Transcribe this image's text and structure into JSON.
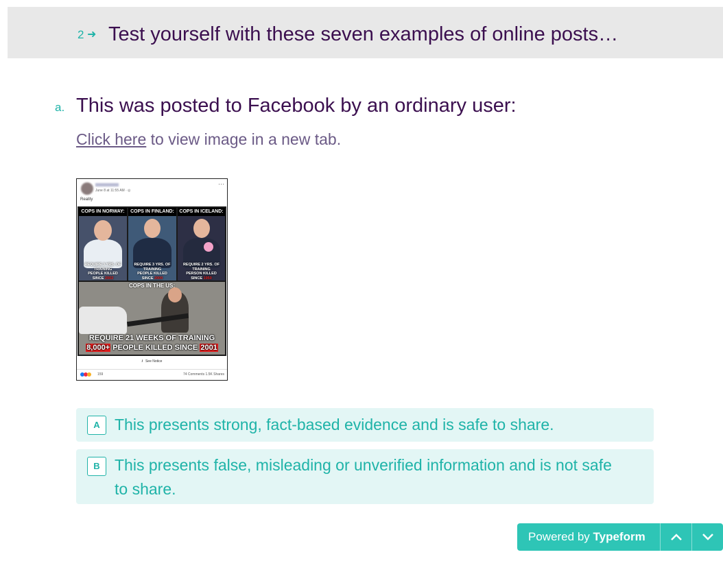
{
  "header": {
    "number": "2",
    "arrow": "➜",
    "title": "Test yourself with these seven examples of online posts…"
  },
  "question": {
    "letter": "a.",
    "title": "This was posted to Facebook by an ordinary user:",
    "link_text": "Click here",
    "link_suffix": " to view image in a new tab."
  },
  "post": {
    "time": "June 8 at 11:55 AM · ",
    "caption": "Reality",
    "more": "···",
    "panels": [
      {
        "title": "COPS IN NORWAY:",
        "line1": "REQUIRE 3 YRS. OF TRAINING",
        "line2": "PEOPLE KILLED",
        "line3a": "SINCE ",
        "line3b": "2002"
      },
      {
        "title": "COPS IN FINLAND:",
        "line1": "REQUIRE 3 YRS. OF TRAINING",
        "line2": "PEOPLE KILLED",
        "line3a": "SINCE ",
        "line3b": "2000"
      },
      {
        "title": "COPS IN ICELAND:",
        "line1": "REQUIRE 2 YRS. OF TRAINING",
        "line2": "PERSON KILLED",
        "line3a": "SINCE ",
        "line3b": "1950"
      }
    ],
    "us_title": "COPS IN THE US:",
    "us_line1": "REQUIRE 21 WEEKS OF TRAINING",
    "us_count": "8,000+",
    "us_line2": " PEOPLE KILLED SINCE ",
    "us_year": "2001",
    "notice_icon": "i",
    "notice": "See Notice",
    "reactions": "159",
    "stats": "74 Comments  1.5K Shares"
  },
  "options": [
    {
      "key": "A",
      "text": "This presents strong, fact-based evidence and is safe to share."
    },
    {
      "key": "B",
      "text": "This presents false, misleading or unverified information and is not safe to share."
    }
  ],
  "powered": {
    "prefix": "Powered by ",
    "brand": "Typeform",
    "up_icon": "chevron-up-icon",
    "down_icon": "chevron-down-icon"
  },
  "colors": {
    "accent": "#1fb3a8",
    "title": "#3b0f4f",
    "option_bg": "#e3f6f5",
    "powered_bg": "#2ec5b6",
    "header_bg": "#e8e8e8"
  }
}
